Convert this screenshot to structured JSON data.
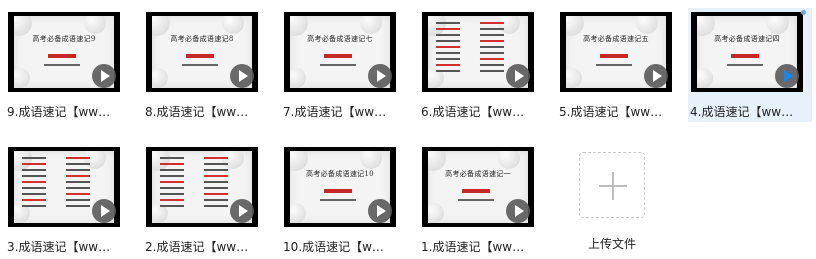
{
  "files": [
    {
      "name": "9.成语速记【ww…",
      "slide_title": "高考必备成语速记9",
      "kind": "title"
    },
    {
      "name": "8.成语速记【ww…",
      "slide_title": "高考必备成语速记8",
      "kind": "title"
    },
    {
      "name": "7.成语速记【ww…",
      "slide_title": "高考必备成语速记七",
      "kind": "title"
    },
    {
      "name": "6.成语速记【ww…",
      "slide_title": "",
      "kind": "list"
    },
    {
      "name": "5.成语速记【ww…",
      "slide_title": "高考必备成语速记五",
      "kind": "title"
    },
    {
      "name": "4.成语速记【ww…",
      "slide_title": "高考必备成语速记四",
      "kind": "title",
      "selected": true
    },
    {
      "name": "3.成语速记【ww…",
      "slide_title": "",
      "kind": "list"
    },
    {
      "name": "2.成语速记【ww…",
      "slide_title": "",
      "kind": "list"
    },
    {
      "name": "10.成语速记【w…",
      "slide_title": "高考必备成语速记10",
      "kind": "title"
    },
    {
      "name": "1.成语速记【ww…",
      "slide_title": "高考必备成语速记一",
      "kind": "title"
    }
  ],
  "upload": {
    "label": "上传文件",
    "icon": "plus-icon"
  },
  "colors": {
    "selected_bg": "#e7f1fb",
    "accent": "#1e88e5",
    "slide_red": "#c62828"
  }
}
